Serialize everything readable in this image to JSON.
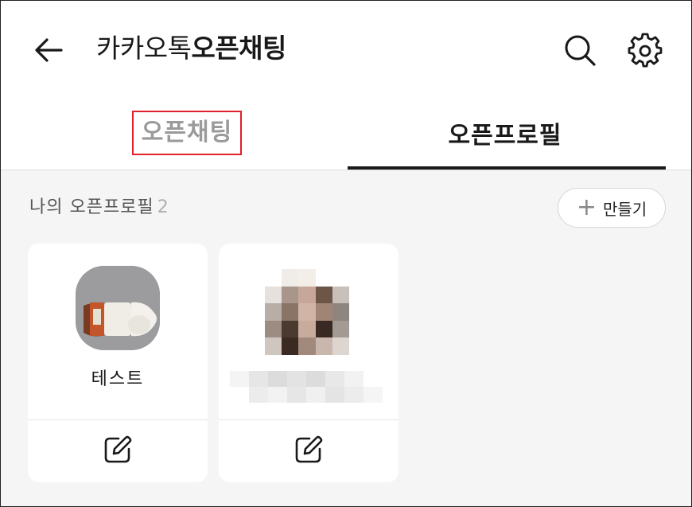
{
  "header": {
    "title_regular": "카카오톡",
    "title_bold": "오픈채팅"
  },
  "tabs": [
    {
      "label": "오픈채팅",
      "selected": false,
      "highlighted": true
    },
    {
      "label": "오픈프로필",
      "selected": true
    }
  ],
  "section": {
    "title": "나의 오픈프로필",
    "count": "2",
    "create_label": "만들기",
    "create_icon": "plus-icon"
  },
  "profiles": [
    {
      "name": "테스트",
      "avatar": "product-photo",
      "edit_icon": "edit-icon"
    },
    {
      "name": "",
      "avatar": "blurred-photo",
      "edit_icon": "edit-icon"
    }
  ],
  "icons": {
    "back": "arrow-left-icon",
    "search": "search-icon",
    "settings": "gear-icon"
  },
  "colors": {
    "highlight_border": "#e0202a",
    "active_tab": "#191919",
    "inactive_tab": "#9a9a9a",
    "content_bg": "#f5f5f5"
  }
}
